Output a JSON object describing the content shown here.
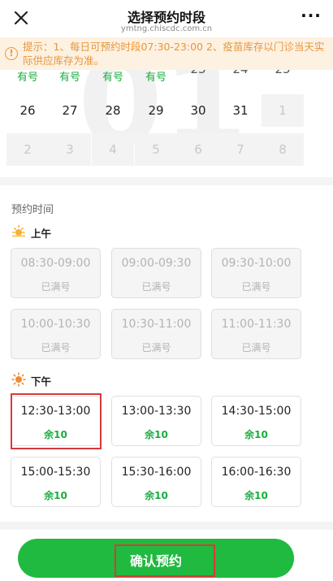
{
  "header": {
    "title": "选择预约时段",
    "subtitle": "ymtng.chiscdc.com.cn",
    "more_label": "···"
  },
  "notice": {
    "text": "提示：1、每日可预约时段07:30-23:00 2、疫苗库存以门诊当天实际供应库存为准。"
  },
  "calendar": {
    "top_row": {
      "badges": [
        "有号",
        "有号",
        "有号",
        "有号"
      ],
      "numbers": [
        "23",
        "24",
        "25"
      ]
    },
    "row2": [
      "26",
      "27",
      "28",
      "29",
      "30",
      "31",
      "1"
    ],
    "row3": [
      "2",
      "3",
      "4",
      "5",
      "6",
      "7",
      "8"
    ]
  },
  "section_label": "预约时间",
  "morning": {
    "label": "上午",
    "slots": [
      {
        "time": "08:30-09:00",
        "status": "已满号"
      },
      {
        "time": "09:00-09:30",
        "status": "已满号"
      },
      {
        "time": "09:30-10:00",
        "status": "已满号"
      },
      {
        "time": "10:00-10:30",
        "status": "已满号"
      },
      {
        "time": "10:30-11:00",
        "status": "已满号"
      },
      {
        "time": "11:00-11:30",
        "status": "已满号"
      }
    ]
  },
  "afternoon": {
    "label": "下午",
    "slots": [
      {
        "time": "12:30-13:00",
        "status": "余10"
      },
      {
        "time": "13:00-13:30",
        "status": "余10"
      },
      {
        "time": "14:30-15:00",
        "status": "余10"
      },
      {
        "time": "15:00-15:30",
        "status": "余10"
      },
      {
        "time": "15:30-16:00",
        "status": "余10"
      },
      {
        "time": "16:00-16:30",
        "status": "余10"
      }
    ]
  },
  "confirm": {
    "label": "确认预约"
  },
  "colors": {
    "accent": "#1fba3f",
    "notice": "#e8963a",
    "highlight": "#d73a3a"
  }
}
